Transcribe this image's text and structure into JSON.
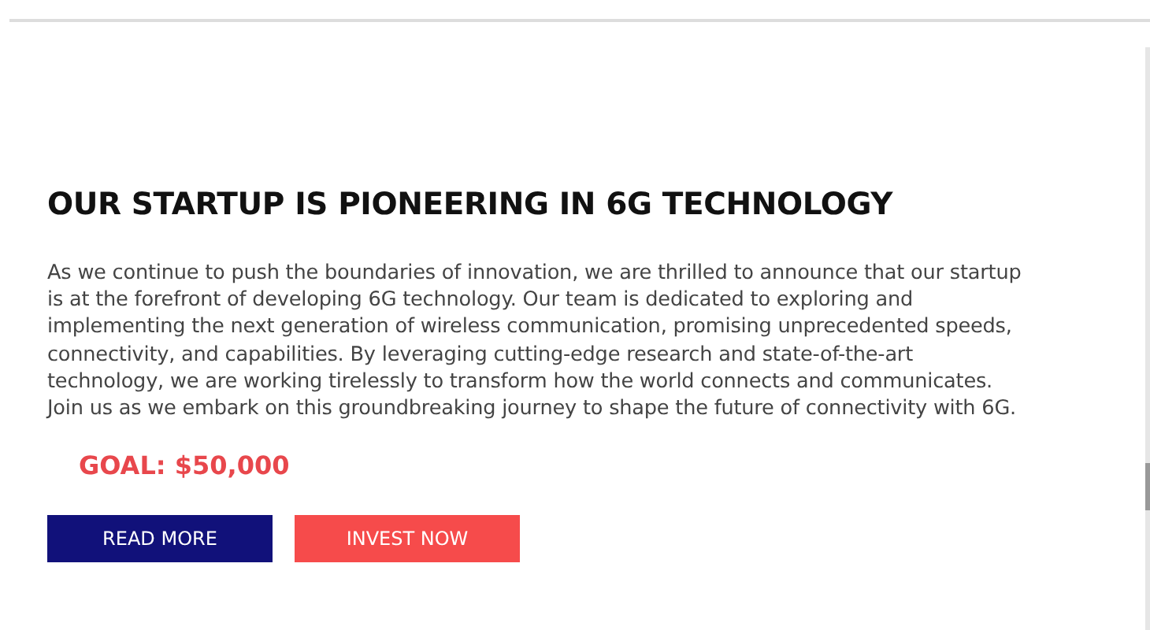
{
  "heading": "OUR STARTUP IS PIONEERING IN 6G TECHNOLOGY",
  "paragraph": "As we continue to push the boundaries of innovation, we are thrilled to announce that our startup is at the forefront of developing 6G technology. Our team is dedicated to exploring and implementing the next generation of wireless communication, promising unprecedented speeds, connectivity, and capabilities. By leveraging cutting-edge research and state-of-the-art technology, we are working tirelessly to transform how the world connects and communicates. Join us as we embark on this groundbreaking journey to shape the future of connectivity with 6G.",
  "goal": "GOAL: $50,000",
  "buttons": [
    {
      "label": "READ MORE",
      "kind": "primary"
    },
    {
      "label": "INVEST NOW",
      "kind": "accent"
    }
  ]
}
